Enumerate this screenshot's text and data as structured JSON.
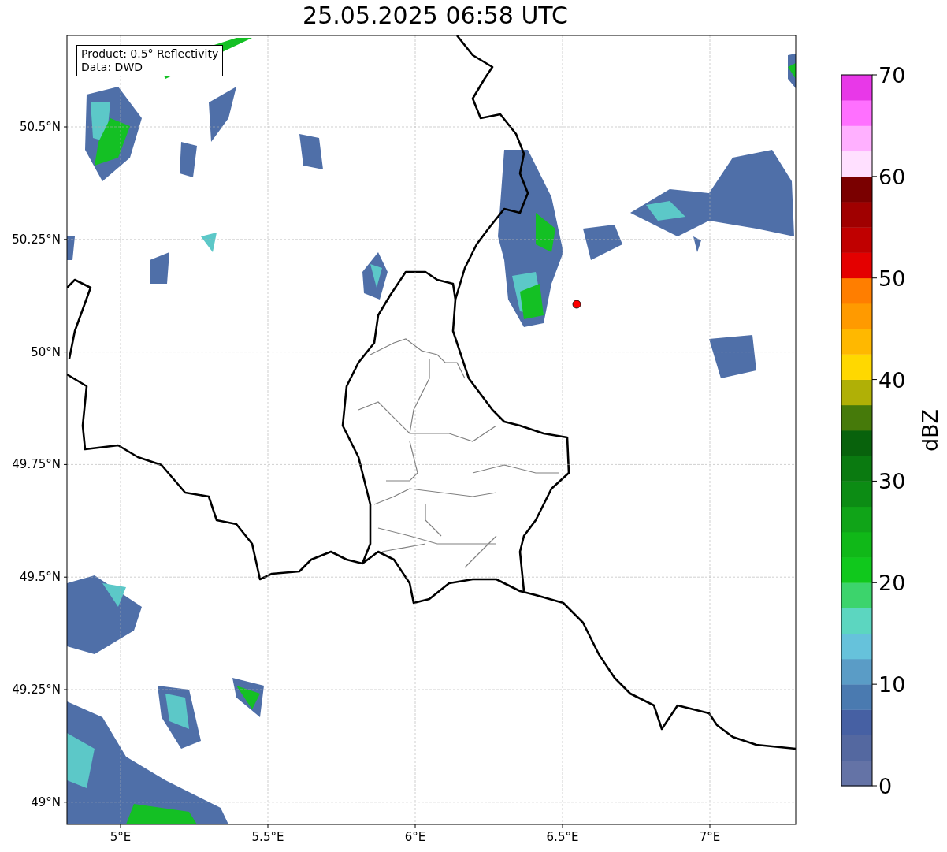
{
  "title": "25.05.2025 06:58 UTC",
  "map": {
    "legend": [
      "Product: 0.5° Reflectivity",
      "Data: DWD"
    ],
    "yticks": [
      "50.5°N",
      "50.25°N",
      "50°N",
      "49.75°N",
      "49.5°N",
      "49.25°N",
      "49°N"
    ],
    "xticks": [
      "5°E",
      "5.5°E",
      "6°E",
      "6.5°E",
      "7°E"
    ]
  },
  "colorbar": {
    "label": "dBZ",
    "ticks": [
      "70",
      "60",
      "50",
      "40",
      "30",
      "20",
      "10",
      "0"
    ],
    "bands": [
      {
        "color": "#6473a6"
      },
      {
        "color": "#5468a0"
      },
      {
        "color": "#4660a3"
      },
      {
        "color": "#4a7ab0"
      },
      {
        "color": "#5a9cc6"
      },
      {
        "color": "#66c2db"
      },
      {
        "color": "#5cd6c0"
      },
      {
        "color": "#3cd46c"
      },
      {
        "color": "#10c81c"
      },
      {
        "color": "#10b818"
      },
      {
        "color": "#10a418"
      },
      {
        "color": "#0c8c14"
      },
      {
        "color": "#0a7a10"
      },
      {
        "color": "#08620c"
      },
      {
        "color": "#467a0a"
      },
      {
        "color": "#b0b006"
      },
      {
        "color": "#ffd800"
      },
      {
        "color": "#ffb800"
      },
      {
        "color": "#ff9a00"
      },
      {
        "color": "#ff7e00"
      },
      {
        "color": "#e40000"
      },
      {
        "color": "#c00000"
      },
      {
        "color": "#a00000"
      },
      {
        "color": "#7a0000"
      },
      {
        "color": "#ffe0ff"
      },
      {
        "color": "#ffb0ff"
      },
      {
        "color": "#ff70ff"
      },
      {
        "color": "#e838e8"
      }
    ]
  }
}
